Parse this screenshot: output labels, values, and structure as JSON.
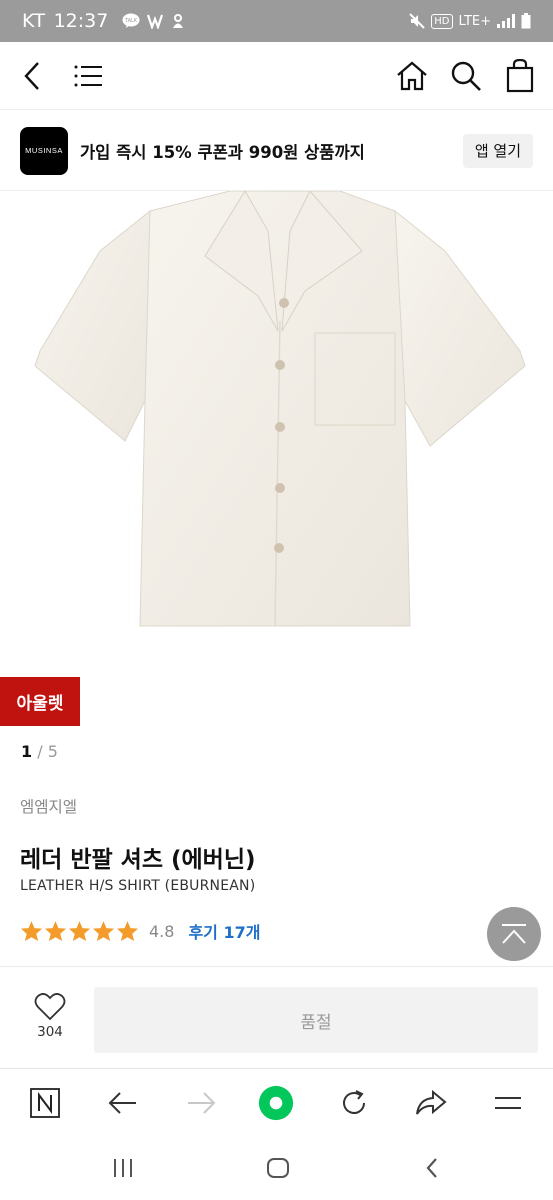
{
  "status_bar": {
    "carrier": "KT",
    "time": "12:37",
    "talk_badge": "TALK",
    "hd_badge": "HD",
    "network": "LTE+",
    "left_icons": [
      "kakaotalk-icon",
      "vpn-key-icon",
      "notification-icon"
    ],
    "right_icons": [
      "mute-icon",
      "hd-voice-icon",
      "lte-icon",
      "signal-icon",
      "battery-icon"
    ]
  },
  "top_nav": {
    "icons": [
      "back-arrow-icon",
      "menu-icon",
      "home-icon",
      "search-icon",
      "shopping-bag-icon"
    ]
  },
  "banner": {
    "logo_text": "MUSINSA",
    "message": "가입 즉시 15% 쿠폰과 990원 상품까지",
    "open_app_label": "앱 열기"
  },
  "product": {
    "outlet_label": "아울렛",
    "pager_current": "1",
    "pager_separator": "/",
    "pager_total": "5",
    "brand": "엠엠지엘",
    "title_ko": "레더 반팔 셔츠 (에버닌)",
    "title_en": "LEATHER H/S SHIRT (EBURNEAN)",
    "rating_score": "4.8",
    "rating_fraction": 0.96,
    "stars": 5,
    "review_label": "후기 17개"
  },
  "purchase": {
    "like_count": "304",
    "soldout_label": "품절"
  },
  "browser_bar": {
    "icons": [
      "naver-n-icon",
      "back-icon",
      "forward-icon",
      "naver-green-dot-icon",
      "refresh-icon",
      "share-icon",
      "menu-icon"
    ]
  },
  "system_nav": {
    "icons": [
      "recent-apps-icon",
      "home-icon",
      "back-icon"
    ]
  },
  "colors": {
    "status_bar": "#9b9b9b",
    "outlet_badge": "#c0120f",
    "star": "#f39c2c",
    "review_link": "#1e6fc9",
    "naver_green": "#03c75a",
    "soldout_bg": "#f2f2f2"
  }
}
